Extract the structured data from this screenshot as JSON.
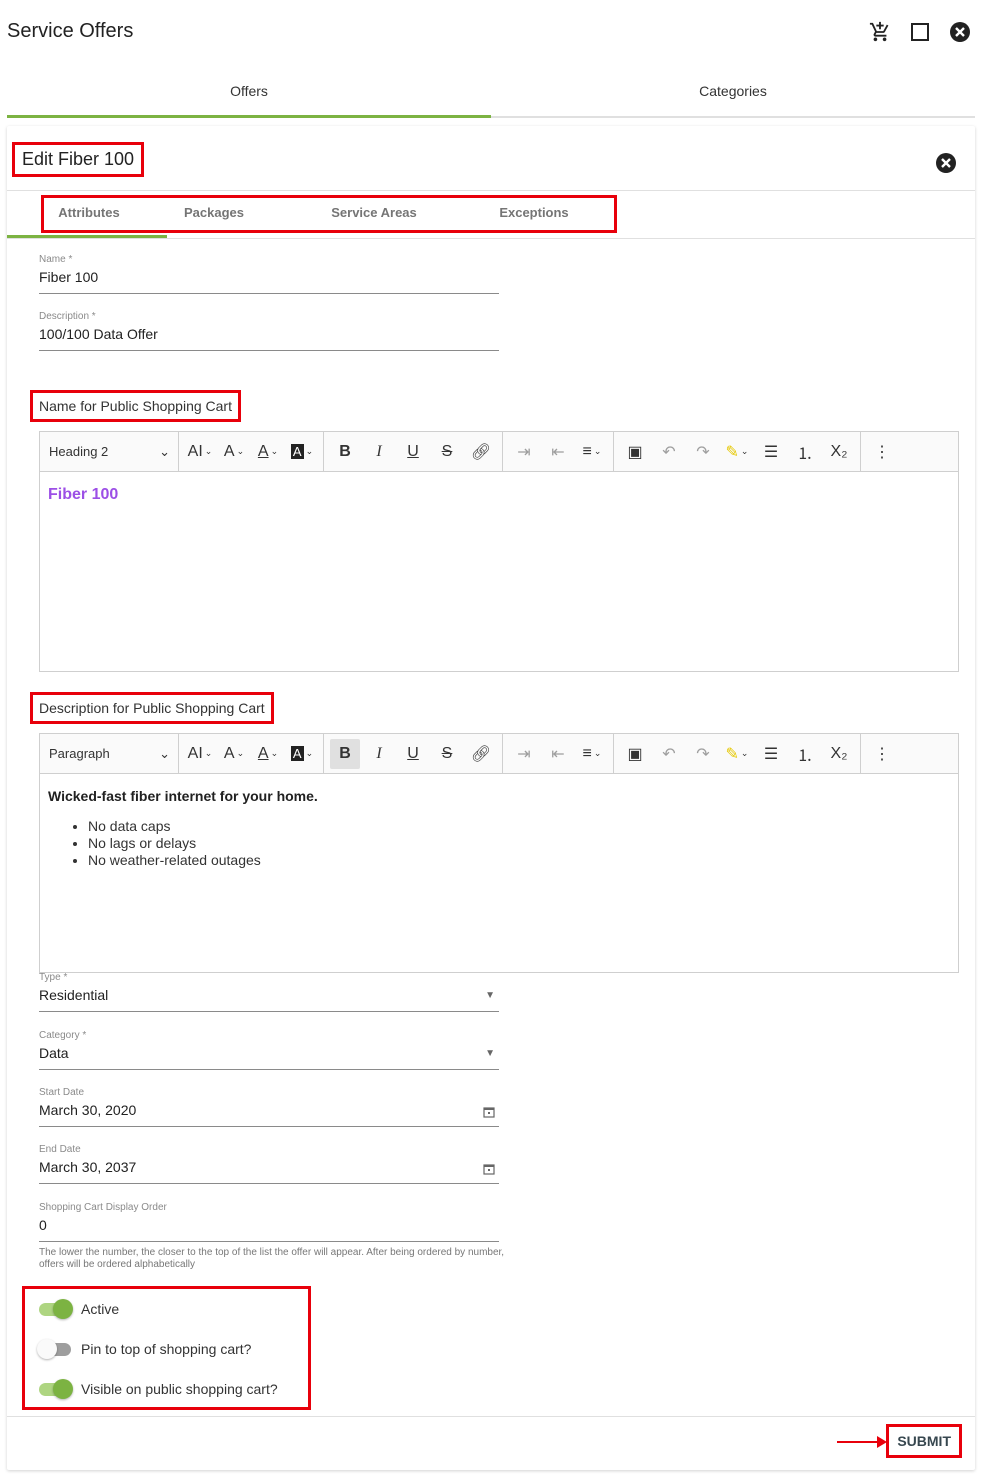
{
  "app": {
    "title": "Service Offers",
    "icons": [
      "add-to-cart-icon",
      "maximize-icon",
      "close-circle-icon"
    ]
  },
  "main_tabs": [
    {
      "label": "Offers",
      "active": true
    },
    {
      "label": "Categories",
      "active": false
    }
  ],
  "card": {
    "title": "Edit Fiber 100",
    "sub_tabs": [
      {
        "label": "Attributes",
        "active": true
      },
      {
        "label": "Packages",
        "active": false
      },
      {
        "label": "Service Areas",
        "active": false
      },
      {
        "label": "Exceptions",
        "active": false
      }
    ]
  },
  "fields": {
    "name": {
      "label": "Name *",
      "value": "Fiber 100"
    },
    "description": {
      "label": "Description *",
      "value": "100/100 Data Offer"
    },
    "type": {
      "label": "Type *",
      "value": "Residential"
    },
    "category": {
      "label": "Category *",
      "value": "Data"
    },
    "start_date": {
      "label": "Start Date",
      "value": "March 30, 2020"
    },
    "end_date": {
      "label": "End Date",
      "value": "March 30, 2037"
    },
    "display_order": {
      "label": "Shopping Cart Display Order",
      "value": "0",
      "hint": "The lower the number, the closer to the top of the list the offer will appear. After being ordered by number, offers will be ordered alphabetically"
    }
  },
  "public_name_editor": {
    "label": "Name for Public Shopping Cart",
    "block_format": "Heading 2",
    "content": "Fiber 100",
    "content_color": "#9c4fe6"
  },
  "public_description_editor": {
    "label": "Description for Public Shopping Cart",
    "block_format": "Paragraph",
    "bold_line": "Wicked-fast fiber internet for your home.",
    "bullets": [
      "No data caps",
      "No lags or delays",
      "No weather-related outages"
    ]
  },
  "toolbar": {
    "font_size": "AI",
    "font_family": "A",
    "font_color": "A",
    "bg_color": "A",
    "bold": "B",
    "italic": "I",
    "underline": "U",
    "strike": "S",
    "subscript": "X₂"
  },
  "toggles": [
    {
      "label": "Active",
      "on": true
    },
    {
      "label": "Pin to top of shopping cart?",
      "on": false
    },
    {
      "label": "Visible on public shopping cart?",
      "on": true
    }
  ],
  "footer": {
    "submit_label": "SUBMIT"
  },
  "colors": {
    "accent": "#7cb342",
    "highlight": "#e8000b"
  }
}
